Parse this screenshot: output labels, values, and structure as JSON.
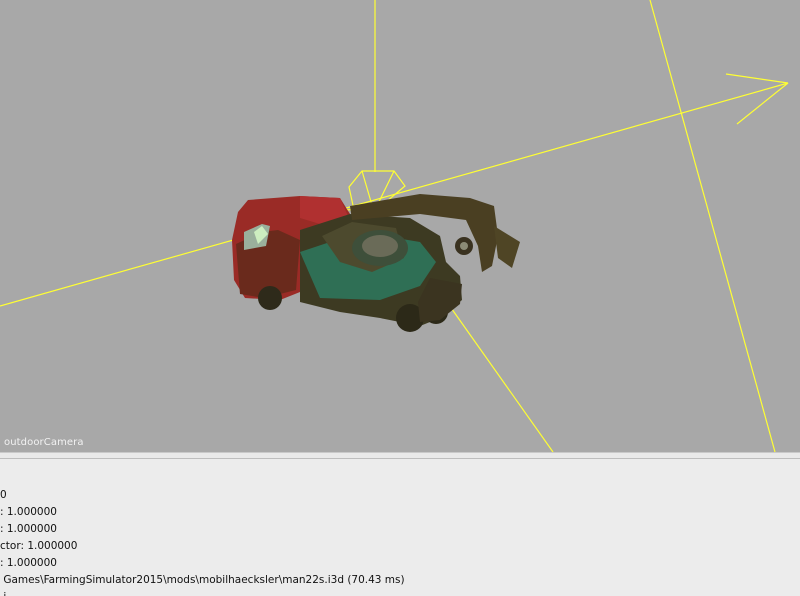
{
  "viewport": {
    "camera_label": "outdoorCamera",
    "gizmo_color": "#ffff33",
    "background_color": "#a8a8a8"
  },
  "log": {
    "lines": [
      "0",
      ": 1.000000",
      ": 1.000000",
      "ctor: 1.000000",
      ": 1.000000",
      " Games\\FarmingSimulator2015\\mods\\mobilhaecksler\\man22s.i3d (70.43 ms)",
      " i                 "
    ]
  }
}
